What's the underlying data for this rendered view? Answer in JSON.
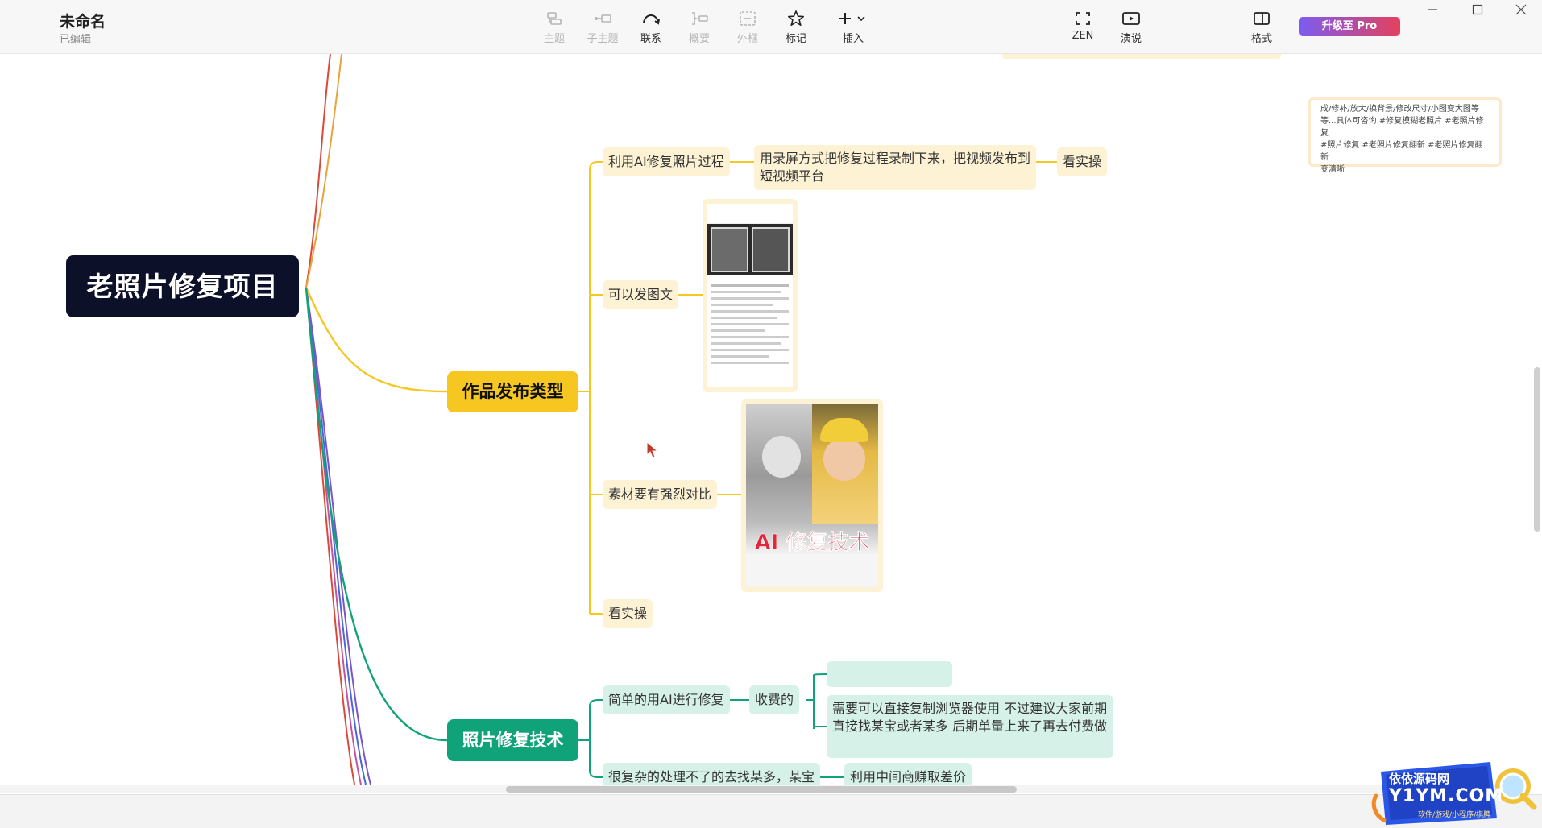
{
  "window": {
    "title": "未命名",
    "status": "已编辑"
  },
  "toolbar": {
    "topic": "主题",
    "subtopic": "子主题",
    "relation": "联系",
    "summary": "概要",
    "boundary": "外框",
    "marker": "标记",
    "insert": "插入",
    "zen": "ZEN",
    "present": "演说",
    "format": "格式",
    "upgrade": "升级至 Pro"
  },
  "mindmap": {
    "root": "老照片修复项目",
    "branches": [
      {
        "label": "作品发布类型",
        "color": "#f6c621",
        "children": [
          {
            "label": "利用AI修复照片过程",
            "detail": "用录屏方式把修复过程录制下来，把视频发布到短视频平台",
            "tag": "看实操"
          },
          {
            "label": "可以发图文"
          },
          {
            "label": "素材要有强烈对比",
            "image_caption": "AI 修复技术"
          },
          {
            "label": "看实操"
          }
        ]
      },
      {
        "label": "照片修复技术",
        "color": "#10a37a",
        "children": [
          {
            "label": "简单的用AI进行修复",
            "detail": "收费的",
            "notes": [
              "",
              "需要可以直接复制浏览器使用 不过建议大家前期直接找某宝或者某多  后期单量上来了再去付费做"
            ]
          },
          {
            "label": "很复杂的处理不了的去找某多，某宝",
            "detail": "利用中间商赚取差价"
          }
        ]
      }
    ]
  },
  "note_card": {
    "line1": "成/修补/放大/换背景/修改尺寸/小图变大图等",
    "line2": "等...具体可咨询 #修复模糊老照片 #老照片修复",
    "line3": "#照片修复 #老照片修复翻新 #老照片修复翻新",
    "line4": "变清晰"
  },
  "watermark": {
    "line1": "依依源码网",
    "line2": "Y1YM.COM",
    "line3": "软件/游戏/小程序/棋牌"
  },
  "colors": {
    "yellow_branch": "#f6c621",
    "green_branch": "#10a37a",
    "root_bg": "#0d1029",
    "upgrade_start": "#7b5cf0",
    "upgrade_end": "#e4415d"
  }
}
